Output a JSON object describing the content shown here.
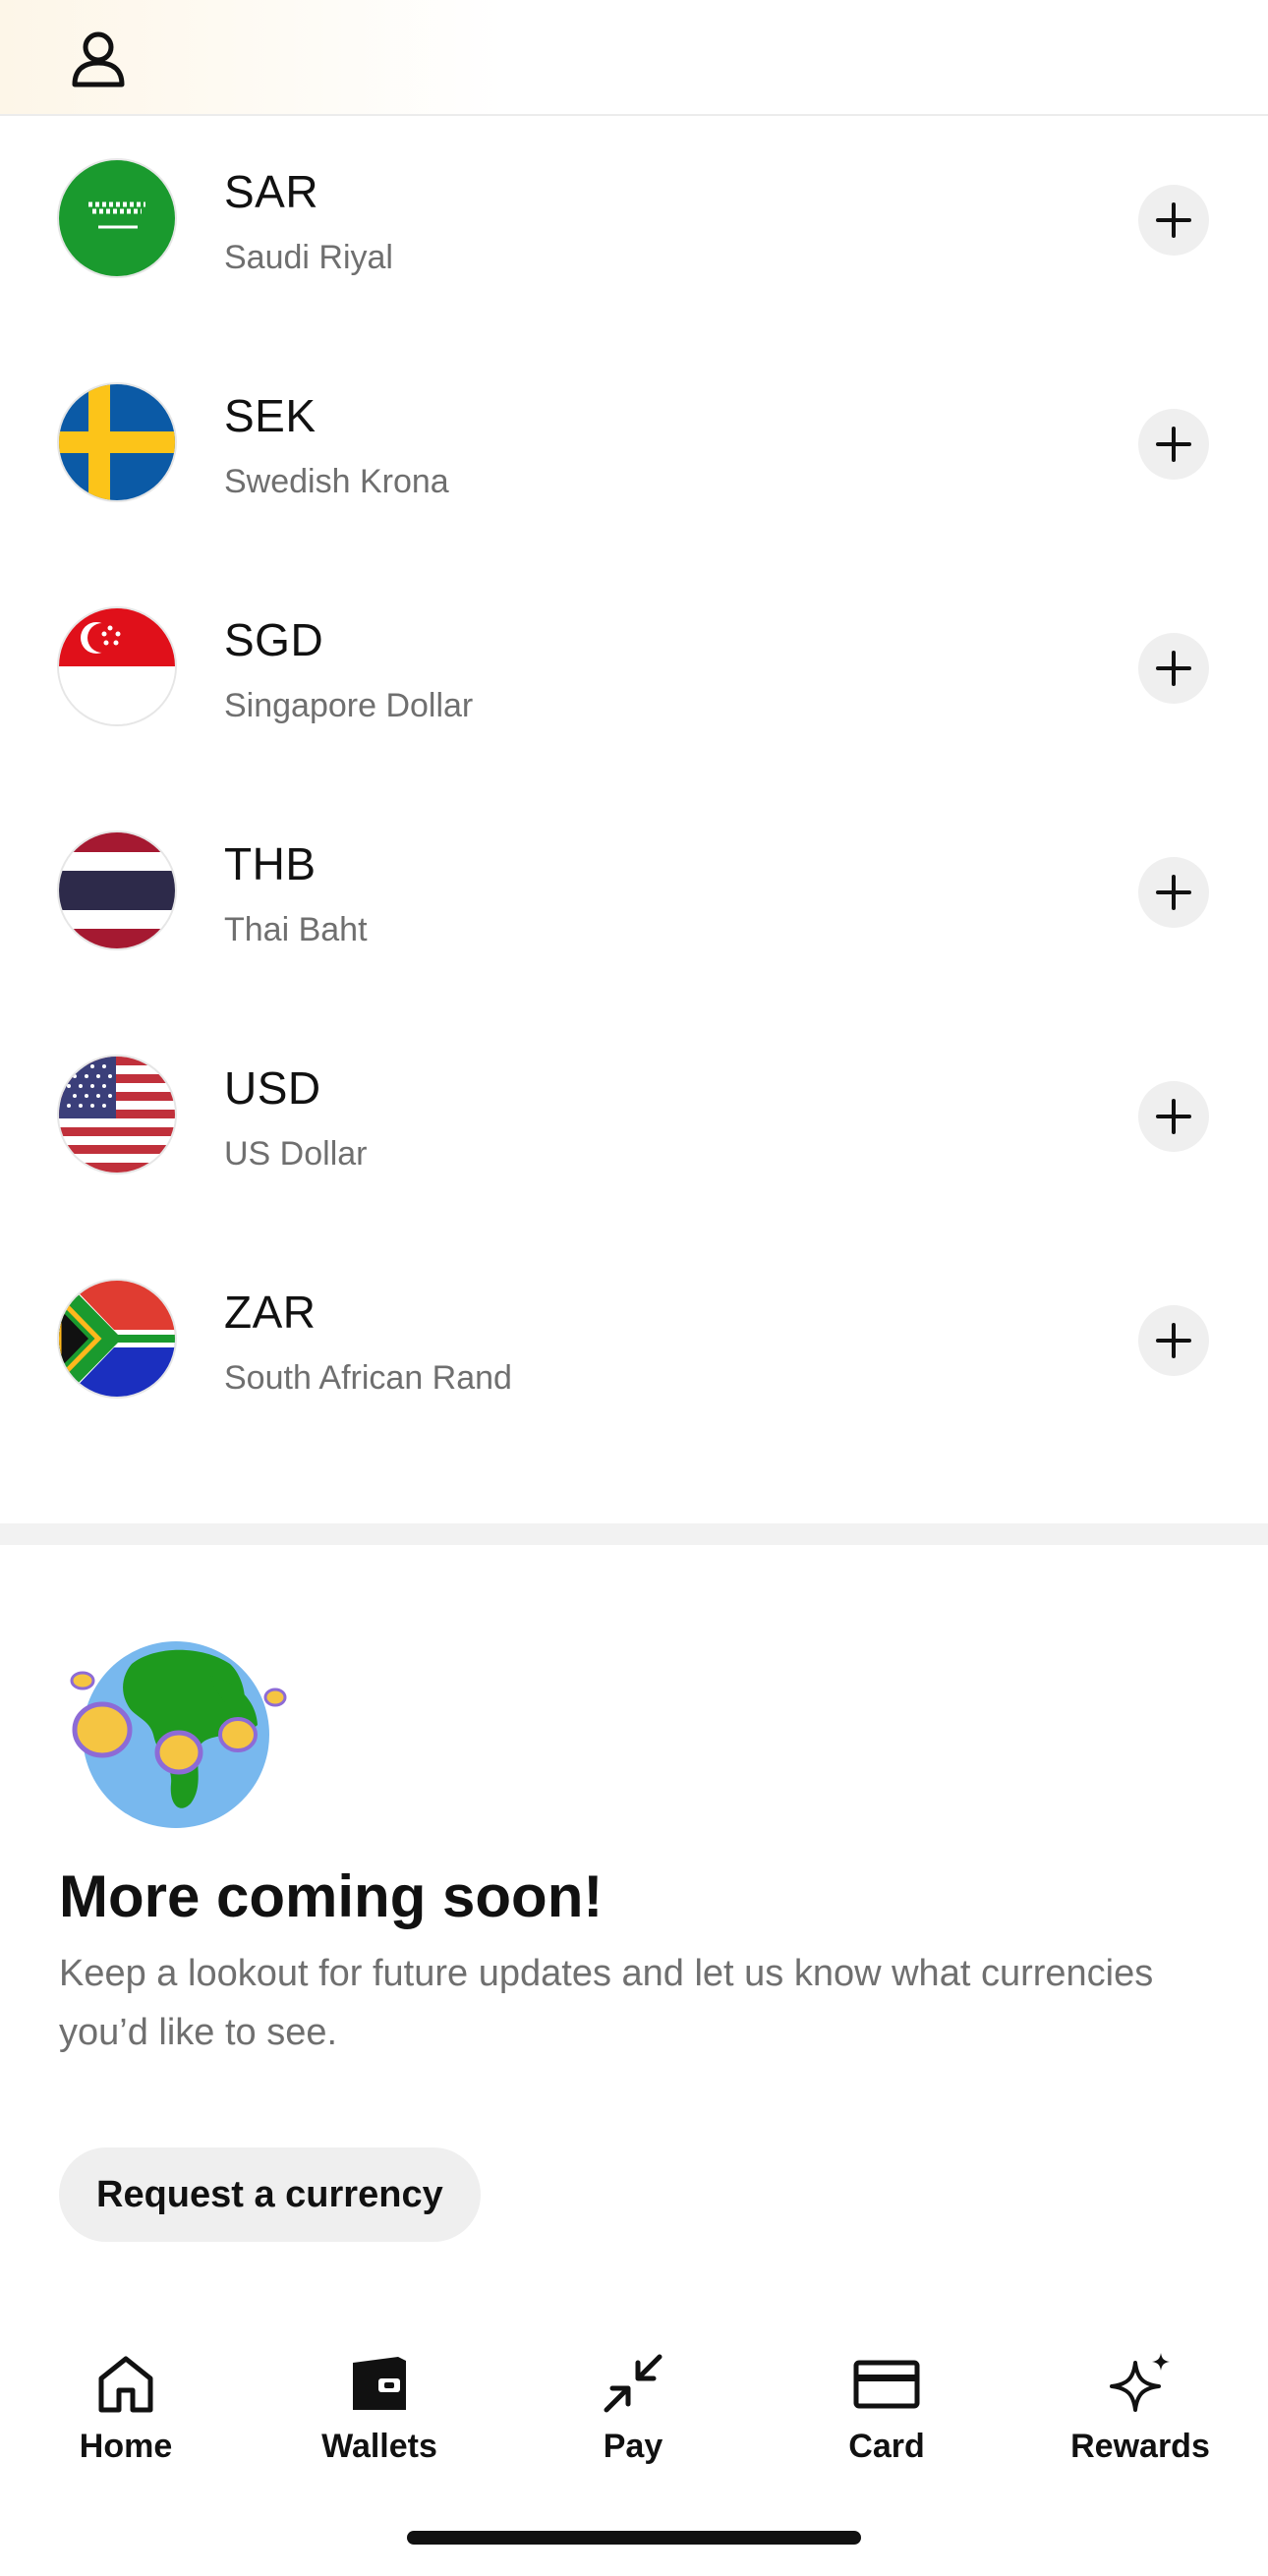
{
  "header": {
    "profile_icon": "person-icon"
  },
  "currencies": [
    {
      "code": "SAR",
      "name": "Saudi Riyal",
      "flag": "saudi-arabia-flag-icon"
    },
    {
      "code": "SEK",
      "name": "Swedish Krona",
      "flag": "sweden-flag-icon"
    },
    {
      "code": "SGD",
      "name": "Singapore Dollar",
      "flag": "singapore-flag-icon"
    },
    {
      "code": "THB",
      "name": "Thai Baht",
      "flag": "thailand-flag-icon"
    },
    {
      "code": "USD",
      "name": "US Dollar",
      "flag": "usa-flag-icon"
    },
    {
      "code": "ZAR",
      "name": "South African Rand",
      "flag": "south-africa-flag-icon"
    }
  ],
  "coming_soon": {
    "title": "More coming soon!",
    "text": "Keep a lookout for future updates and let us know what currencies you’d like to see.",
    "button": "Request a currency"
  },
  "nav": [
    {
      "label": "Home",
      "icon": "home-icon"
    },
    {
      "label": "Wallets",
      "icon": "wallet-icon"
    },
    {
      "label": "Pay",
      "icon": "pay-arrows-icon"
    },
    {
      "label": "Card",
      "icon": "card-icon"
    },
    {
      "label": "Rewards",
      "icon": "sparkle-icon"
    }
  ],
  "colors": {
    "button_bg": "#efefef",
    "secondary_text": "#6f6f6f"
  }
}
